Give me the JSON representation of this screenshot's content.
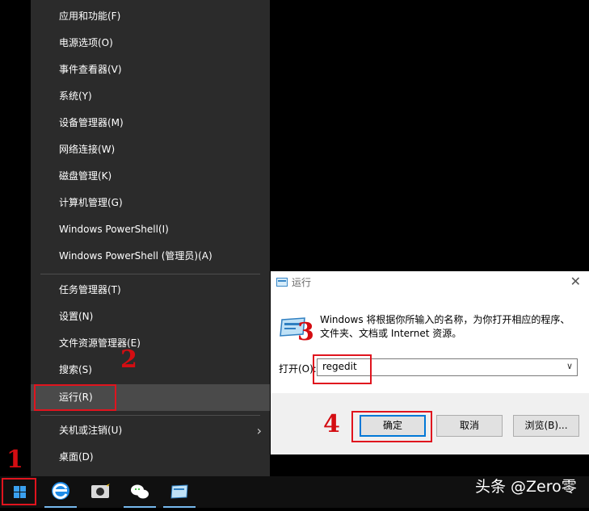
{
  "context_menu": {
    "items": [
      {
        "label": "应用和功能(F)"
      },
      {
        "label": "电源选项(O)"
      },
      {
        "label": "事件查看器(V)"
      },
      {
        "label": "系统(Y)"
      },
      {
        "label": "设备管理器(M)"
      },
      {
        "label": "网络连接(W)"
      },
      {
        "label": "磁盘管理(K)"
      },
      {
        "label": "计算机管理(G)"
      },
      {
        "label": "Windows PowerShell(I)"
      },
      {
        "label": "Windows PowerShell (管理员)(A)"
      },
      {
        "label": "任务管理器(T)"
      },
      {
        "label": "设置(N)"
      },
      {
        "label": "文件资源管理器(E)"
      },
      {
        "label": "搜索(S)"
      },
      {
        "label": "运行(R)",
        "selected": true
      },
      {
        "label": "关机或注销(U)",
        "submenu": true
      },
      {
        "label": "桌面(D)"
      }
    ]
  },
  "run_dialog": {
    "title": "运行",
    "description": "Windows 将根据你所输入的名称，为你打开相应的程序、文件夹、文档或 Internet 资源。",
    "open_label": "打开(O):",
    "open_value": "regedit",
    "ok_label": "确定",
    "cancel_label": "取消",
    "browse_label": "浏览(B)..."
  },
  "annotations": {
    "step1": "1",
    "step2": "2",
    "step3": "3",
    "step4": "4",
    "color": "#e0141e"
  },
  "taskbar": {
    "icons": [
      "start-windows-icon",
      "edge-browser-icon",
      "camera-app-icon",
      "wechat-icon",
      "run-app-icon"
    ]
  },
  "watermark": "头条 @Zero零"
}
